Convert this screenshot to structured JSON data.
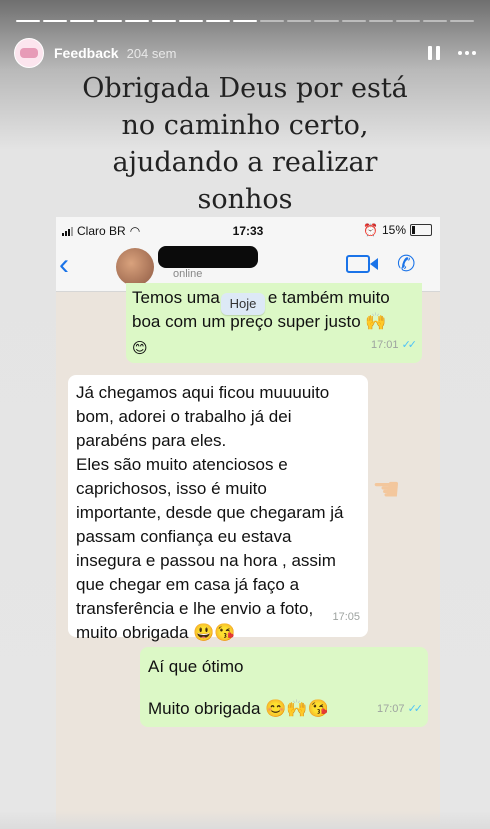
{
  "story": {
    "account_name": "Feedback",
    "age": "204 sem",
    "caption_lines": [
      "Obrigada Deus por está",
      "no caminho certo,",
      "ajudando a realizar",
      "sonhos"
    ],
    "progress": {
      "segments": 17,
      "completed": 9
    }
  },
  "phone_status": {
    "carrier": "Claro BR",
    "time": "17:33",
    "battery": "15%",
    "icons": [
      "signal-icon",
      "wifi-icon",
      "alarm-icon",
      "battery-icon"
    ]
  },
  "chat_header": {
    "status": "online",
    "icons": [
      "back-icon",
      "video-call-icon",
      "phone-icon"
    ]
  },
  "date_chip": "Hoje",
  "messages": [
    {
      "direction": "outgoing",
      "lines": [
        "Temos uma",
        "e também muito",
        "boa com um preço super justo 🙌",
        "😊"
      ],
      "time": "17:01",
      "read": true
    },
    {
      "direction": "incoming",
      "lines": [
        "Já chegamos aqui ficou muuuuito",
        "bom, adorei o trabalho já dei",
        "parabéns para eles.",
        "Eles são muito atenciosos e",
        "caprichosos, isso é muito",
        "importante, desde que chegaram já",
        "passam confiança eu estava",
        "insegura e passou na hora ,  assim",
        "que chegar em casa já faço a",
        "transferência e lhe envio a foto,",
        "muito obrigada 😃😘"
      ],
      "time": "17:05"
    },
    {
      "direction": "outgoing",
      "lines": [
        "Aí que ótimo",
        "",
        "Muito obrigada 😊🙌😘"
      ],
      "time": "17:07",
      "read": true
    }
  ],
  "colors": {
    "outgoing_bubble": "#dcf8c6",
    "incoming_bubble": "#ffffff",
    "chat_background": "#ebe4dc",
    "accent": "#1a73e8"
  }
}
